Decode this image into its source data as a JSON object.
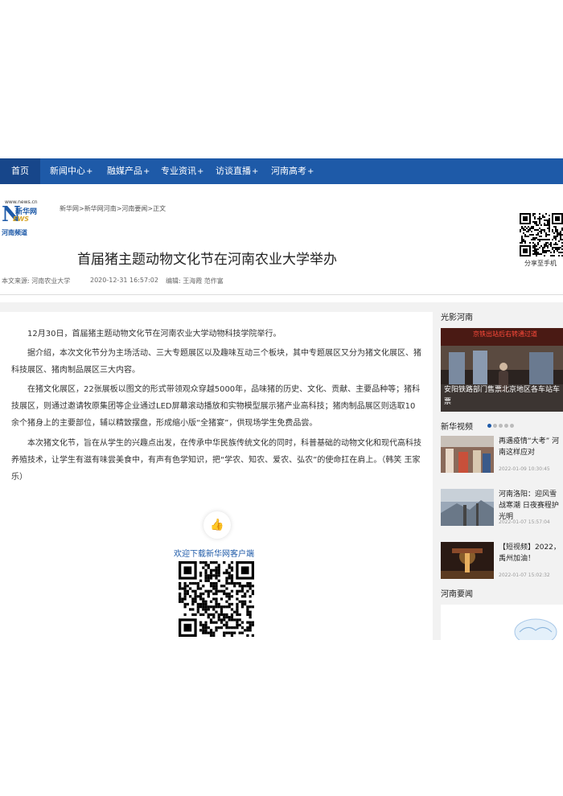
{
  "nav": {
    "items": [
      {
        "label": "首页",
        "plus": ""
      },
      {
        "label": "新闻中心",
        "plus": "+"
      },
      {
        "label": "融媒产品",
        "plus": "+"
      },
      {
        "label": "专业资讯",
        "plus": "+"
      },
      {
        "label": "访谈直播",
        "plus": "+"
      },
      {
        "label": "河南高考",
        "plus": "+"
      }
    ]
  },
  "logo": {
    "url": "www.news.cn",
    "letter": "N",
    "cn": "新华网",
    "ews": "EWS",
    "sub": "河南频道"
  },
  "breadcrumb": {
    "items": [
      "新华网",
      "新华网河南",
      "河南要闻",
      "正文"
    ],
    "separator": ">"
  },
  "article": {
    "title": "首届猪主题动物文化节在河南农业大学举办",
    "source_label": "本文来源:",
    "source": "河南农业大学",
    "datetime": "2020-12-31 16:57:02",
    "editor_label": "编辑:",
    "editor": "王海霞 范作富",
    "paragraphs": [
      "12月30日，首届猪主题动物文化节在河南农业大学动物科技学院举行。",
      "据介绍，本次文化节分为主场活动、三大专题展区以及趣味互动三个板块，其中专题展区又分为猪文化展区、猪科技展区、猪肉制品展区三大内容。",
      "在猪文化展区，22张展板以图文的形式带领观众穿越5000年，品味猪的历史、文化、贡献、主要品种等；猪科技展区，则通过邀请牧原集团等企业通过LED屏幕滚动播放和实物模型展示猪产业高科技；猪肉制品展区则选取10余个猪身上的主要部位，辅以精致摆盘，形成缩小版“全猪宴”，供现场学生免费品尝。",
      "本次猪文化节，旨在从学生的兴趣点出发，在传承中华民族传统文化的同时，科普基础的动物文化和现代高科技养殖技术，让学生有滋有味尝美食中，有声有色学知识，把“学农、知农、爱农、弘农”的使命扛在肩上。（韩笑 王家乐）"
    ]
  },
  "share": {
    "label": "分享至手机"
  },
  "download": {
    "label": "欢迎下载新华网客户端"
  },
  "sidebar": {
    "photo_section": "光影河南",
    "slide_caption": "安阳铁路部门售票北京地区各车站车票",
    "slide_sign": "京铁出站后右转通过道",
    "video_section": "新华视频",
    "videos": [
      {
        "title": "再遇疫情“大考” 河南这样应对",
        "date": "2022-01-09 10:30:45"
      },
      {
        "title": "河南洛阳：迎风雪 战寒潮 日夜赛程护光明",
        "date": "2022-01-07 15:57:04"
      },
      {
        "title": "【短视频】2022，禹州加油！",
        "date": "2022-01-07 15:02:32"
      }
    ],
    "news_section": "河南要闻"
  },
  "colors": {
    "nav_bg": "#1e5aa8",
    "nav_active": "#17468a",
    "accent": "#1e5aa8"
  }
}
